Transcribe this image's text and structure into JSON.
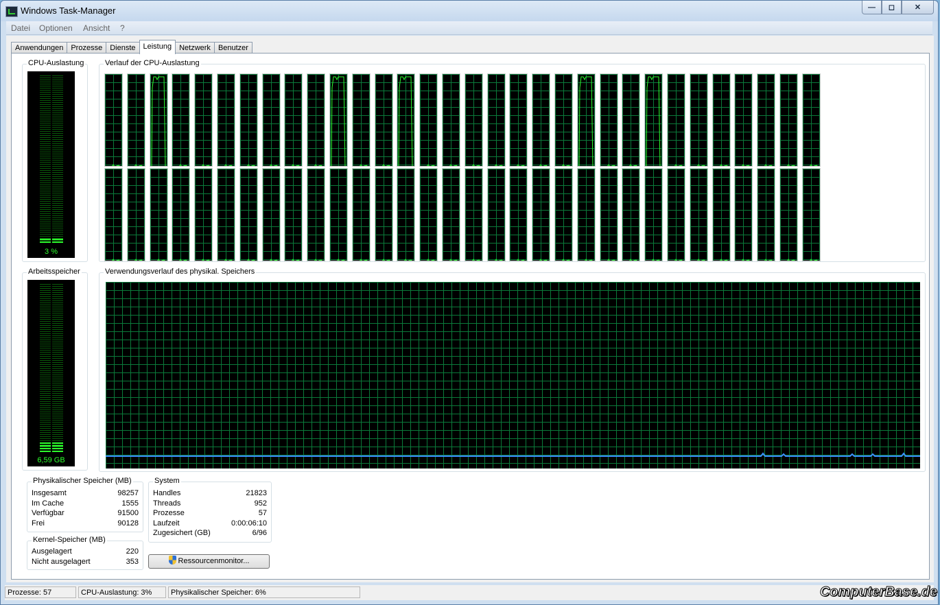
{
  "window": {
    "title": "Windows Task-Manager",
    "caption_buttons": [
      "minimize",
      "maximize",
      "close"
    ]
  },
  "menu": [
    "Datei",
    "Optionen",
    "Ansicht",
    "?"
  ],
  "tabs": [
    {
      "label": "Anwendungen",
      "active": false
    },
    {
      "label": "Prozesse",
      "active": false
    },
    {
      "label": "Dienste",
      "active": false
    },
    {
      "label": "Leistung",
      "active": true
    },
    {
      "label": "Netzwerk",
      "active": false
    },
    {
      "label": "Benutzer",
      "active": false
    }
  ],
  "cpu_usage": {
    "label": "CPU-Auslastung",
    "value_text": "3 %",
    "value_percent": 3
  },
  "cpu_history": {
    "label": "Verlauf der CPU-Auslastung",
    "core_count": 64,
    "rows": 2,
    "columns": 32
  },
  "memory": {
    "label": "Arbeitsspeicher",
    "value_text": "6,59 GB",
    "fill_percent": 6
  },
  "memory_history": {
    "label": "Verwendungsverlauf des physikal. Speichers",
    "usage_percent": 6
  },
  "physical_memory": {
    "label": "Physikalischer Speicher (MB)",
    "rows": [
      {
        "key": "Insgesamt",
        "value": "98257"
      },
      {
        "key": "Im Cache",
        "value": "1555"
      },
      {
        "key": "Verfügbar",
        "value": "91500"
      },
      {
        "key": "Frei",
        "value": "90128"
      }
    ]
  },
  "system": {
    "label": "System",
    "rows": [
      {
        "key": "Handles",
        "value": "21823"
      },
      {
        "key": "Threads",
        "value": "952"
      },
      {
        "key": "Prozesse",
        "value": "57"
      },
      {
        "key": "Laufzeit",
        "value": "0:00:06:10"
      },
      {
        "key": "Zugesichert (GB)",
        "value": "6/96"
      }
    ]
  },
  "kernel_memory": {
    "label": "Kernel-Speicher (MB)",
    "rows": [
      {
        "key": "Ausgelagert",
        "value": "220"
      },
      {
        "key": "Nicht ausgelagert",
        "value": "353"
      }
    ]
  },
  "resource_monitor_button": "Ressourcenmonitor...",
  "statusbar": {
    "processes": "Prozesse: 57",
    "cpu": "CPU-Auslastung: 3%",
    "memory": "Physikalischer Speicher: 6%"
  },
  "watermark": "ComputerBase.de",
  "colors": {
    "graph_grid": "#0b7a3a",
    "graph_line": "#2dff2d",
    "memory_line": "#3a8fff"
  }
}
